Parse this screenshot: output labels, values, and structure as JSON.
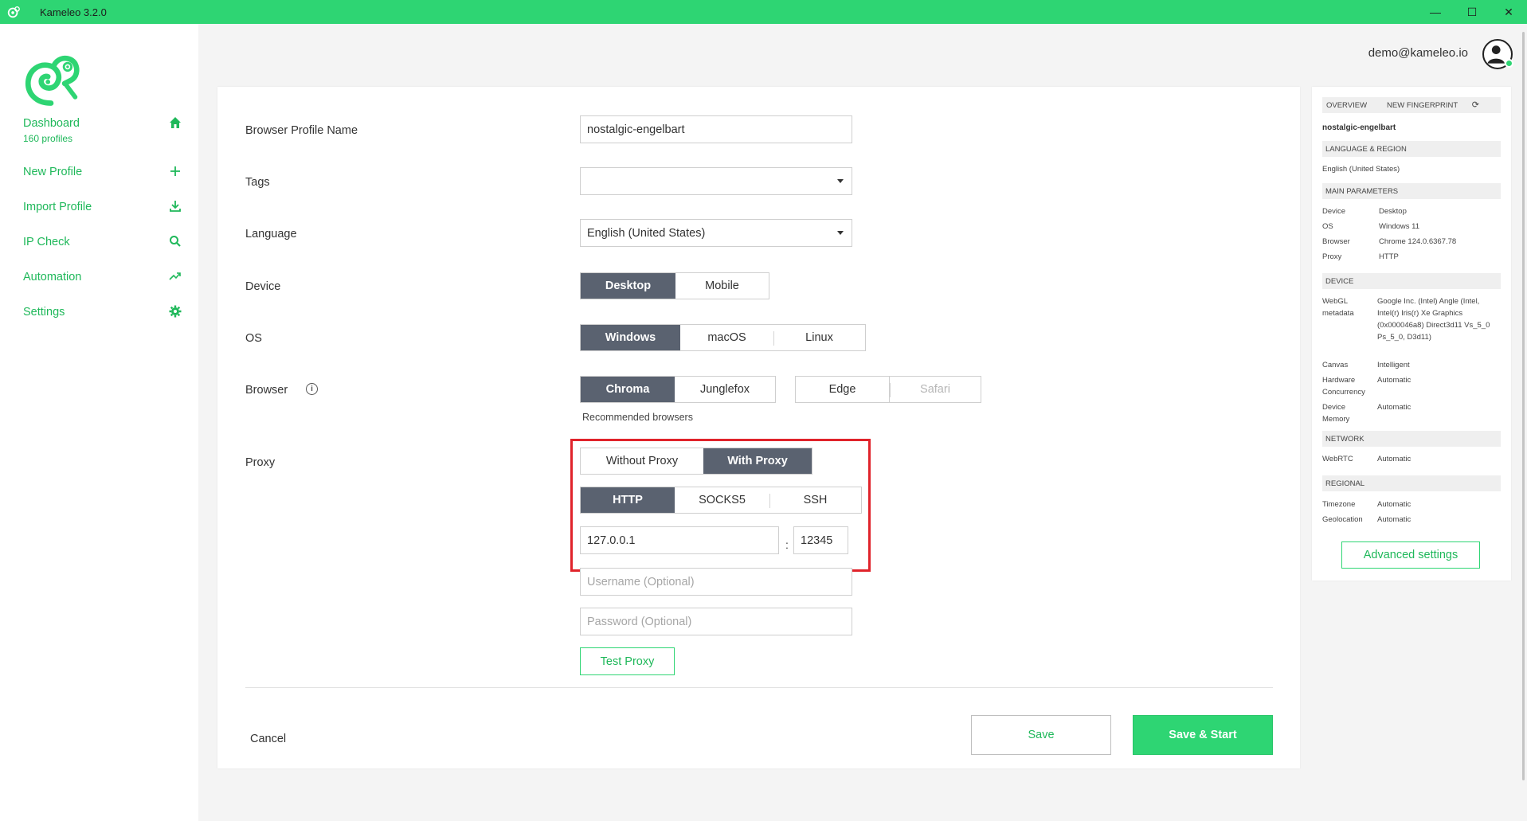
{
  "window": {
    "title": "Kameleo 3.2.0",
    "minimize": "—",
    "maximize": "☐",
    "close": "✕"
  },
  "sidebar": {
    "items": [
      {
        "label": "Dashboard",
        "sub": "160 profiles",
        "icon": "home-icon"
      },
      {
        "label": "New Profile",
        "icon": "plus-icon"
      },
      {
        "label": "Import Profile",
        "icon": "download-icon"
      },
      {
        "label": "IP Check",
        "icon": "search-icon"
      },
      {
        "label": "Automation",
        "icon": "trend-icon"
      },
      {
        "label": "Settings",
        "icon": "gear-icon"
      }
    ]
  },
  "user": {
    "email": "demo@kameleo.io"
  },
  "form": {
    "profile_name_label": "Browser Profile Name",
    "profile_name_value": "nostalgic-engelbart",
    "tags_label": "Tags",
    "tags_value": "",
    "language_label": "Language",
    "language_value": "English (United States)",
    "device_label": "Device",
    "device_options": [
      "Desktop",
      "Mobile"
    ],
    "os_label": "OS",
    "os_options": [
      "Windows",
      "macOS",
      "Linux"
    ],
    "browser_label": "Browser",
    "browser_recommended": [
      "Chroma",
      "Junglefox"
    ],
    "browser_other": [
      "Edge",
      "Safari"
    ],
    "recommended_text": "Recommended browsers",
    "proxy_label": "Proxy",
    "proxy_mode_options": [
      "Without Proxy",
      "With Proxy"
    ],
    "proxy_type_options": [
      "HTTP",
      "SOCKS5",
      "SSH"
    ],
    "proxy_host": "127.0.0.1",
    "proxy_port": "12345",
    "colon": ":",
    "username_placeholder": "Username (Optional)",
    "password_placeholder": "Password (Optional)",
    "test_proxy": "Test Proxy",
    "cancel": "Cancel",
    "save": "Save",
    "save_start": "Save & Start"
  },
  "overview": {
    "tab_overview": "OVERVIEW",
    "tab_new_fingerprint": "NEW FINGERPRINT",
    "profile_name": "nostalgic-engelbart",
    "sec_language": "LANGUAGE & REGION",
    "language": "English (United States)",
    "sec_main": "MAIN PARAMETERS",
    "main": [
      {
        "k": "Device",
        "v": "Desktop"
      },
      {
        "k": "OS",
        "v": "Windows 11"
      },
      {
        "k": "Browser",
        "v": "Chrome 124.0.6367.78"
      },
      {
        "k": "Proxy",
        "v": "HTTP"
      }
    ],
    "sec_device": "DEVICE",
    "webgl_key": "WebGL metadata",
    "webgl_val": "Google Inc. (Intel) Angle (Intel, Intel(r) Iris(r) Xe Graphics (0x000046a8) Direct3d11 Vs_5_0 Ps_5_0, D3d11)",
    "canvas_key": "Canvas",
    "canvas_val": "Intelligent",
    "hw_key": "Hardware Concurrency",
    "hw_val": "Automatic",
    "mem_key": "Device Memory",
    "mem_val": "Automatic",
    "sec_network": "NETWORK",
    "webrtc_key": "WebRTC",
    "webrtc_val": "Automatic",
    "sec_regional": "REGIONAL",
    "tz_key": "Timezone",
    "tz_val": "Automatic",
    "geo_key": "Geolocation",
    "geo_val": "Automatic",
    "advanced": "Advanced settings"
  }
}
